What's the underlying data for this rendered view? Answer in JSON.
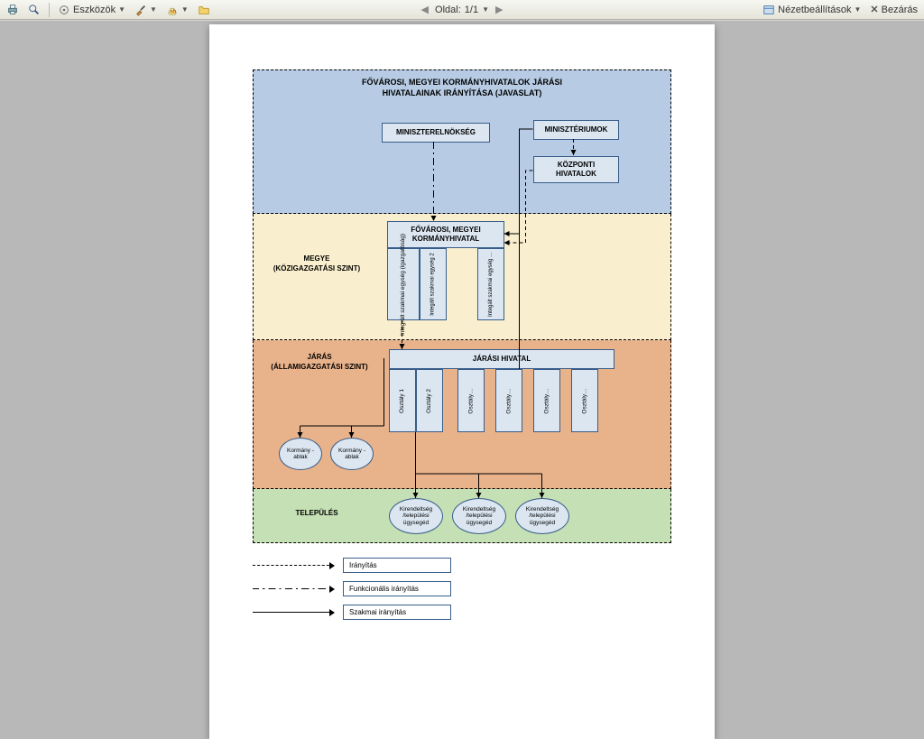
{
  "toolbar": {
    "tools_label": "Eszközök",
    "page_label": "Oldal:",
    "page_value": "1/1",
    "view_settings_label": "Nézetbeállítások",
    "close_label": "Bezárás"
  },
  "diagram": {
    "title_line1": "FŐVÁROSI, MEGYEI KORMÁNYHIVATALOK JÁRÁSI",
    "title_line2": "HIVATALAINAK IRÁNYÍTÁSA (JAVASLAT)",
    "top": {
      "pm_office": "MINISZTERELNÖKSÉG",
      "ministries": "MINISZTÉRIUMOK",
      "central_offices": "KÖZPONTI HIVATALOK"
    },
    "county": {
      "label": "MEGYE (KÖZIGAZGATÁSI SZINT)",
      "gov_office": "FŐVÁROSI, MEGYEI KORMÁNYHIVATAL",
      "cols": [
        "Integrált szakmai egység (igazgatóság)",
        "Integált szakmai egység 2",
        "Integált szakmai egység …"
      ]
    },
    "district": {
      "label": "JÁRÁS (ÁLLAMIGAZGATÁSI SZINT)",
      "district_office": "JÁRÁSI HIVATAL",
      "depts": [
        "Osztály 1",
        "Osztály 2",
        "Osztály…",
        "Osztály…",
        "Osztály…",
        "Osztály…"
      ],
      "gov_windows": [
        "Kormány -ablak",
        "Kormány -ablak"
      ]
    },
    "settlement": {
      "label": "TELEPÜLÉS",
      "branches": [
        "Kirendeltség /települési ügysegéd",
        "Kirendeltség /települési ügysegéd",
        "Kirendeltség /települési ügysegéd"
      ]
    },
    "legend": {
      "direction": "Irányítás",
      "functional": "Funkcionális irányítás",
      "professional": "Szakmai irányítás"
    }
  }
}
